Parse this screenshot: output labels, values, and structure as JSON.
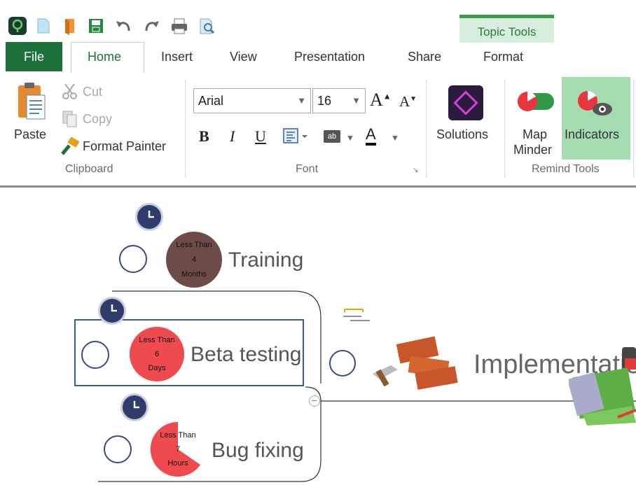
{
  "contextual_tab": {
    "label": "Topic Tools"
  },
  "tabs": [
    "File",
    "Home",
    "Insert",
    "View",
    "Presentation",
    "Share",
    "Format"
  ],
  "clipboard": {
    "paste": "Paste",
    "cut": "Cut",
    "copy": "Copy",
    "format_painter": "Format Painter",
    "group": "Clipboard"
  },
  "font": {
    "family": "Arial",
    "size": "16",
    "bold": "B",
    "italic": "I",
    "underline": "U",
    "grow": "A",
    "shrink": "A",
    "ab": "ab",
    "color_a": "A",
    "group": "Font"
  },
  "solutions": {
    "label": "Solutions"
  },
  "remind_tools": {
    "map_minder_1": "Map",
    "map_minder_2": "Minder",
    "indicators": "Indicators",
    "group": "Remind Tools"
  },
  "topics": {
    "training": {
      "label": "Training",
      "ind1": "Less Than",
      "ind2": "4",
      "ind3": "Months"
    },
    "beta": {
      "label": "Beta testing",
      "ind1": "Less Than",
      "ind2": "6",
      "ind3": "Days"
    },
    "bug": {
      "label": "Bug fixing",
      "ind1": "Less Than",
      "ind2": "7",
      "ind3": "Hours"
    },
    "implementation": {
      "label": "Implementatio"
    }
  },
  "colors": {
    "file_tab": "#1f6f3a",
    "indicator_brown": "#6d4c47",
    "indicator_red": "#ee4a4f",
    "clock_navy": "#2f3b6a"
  }
}
